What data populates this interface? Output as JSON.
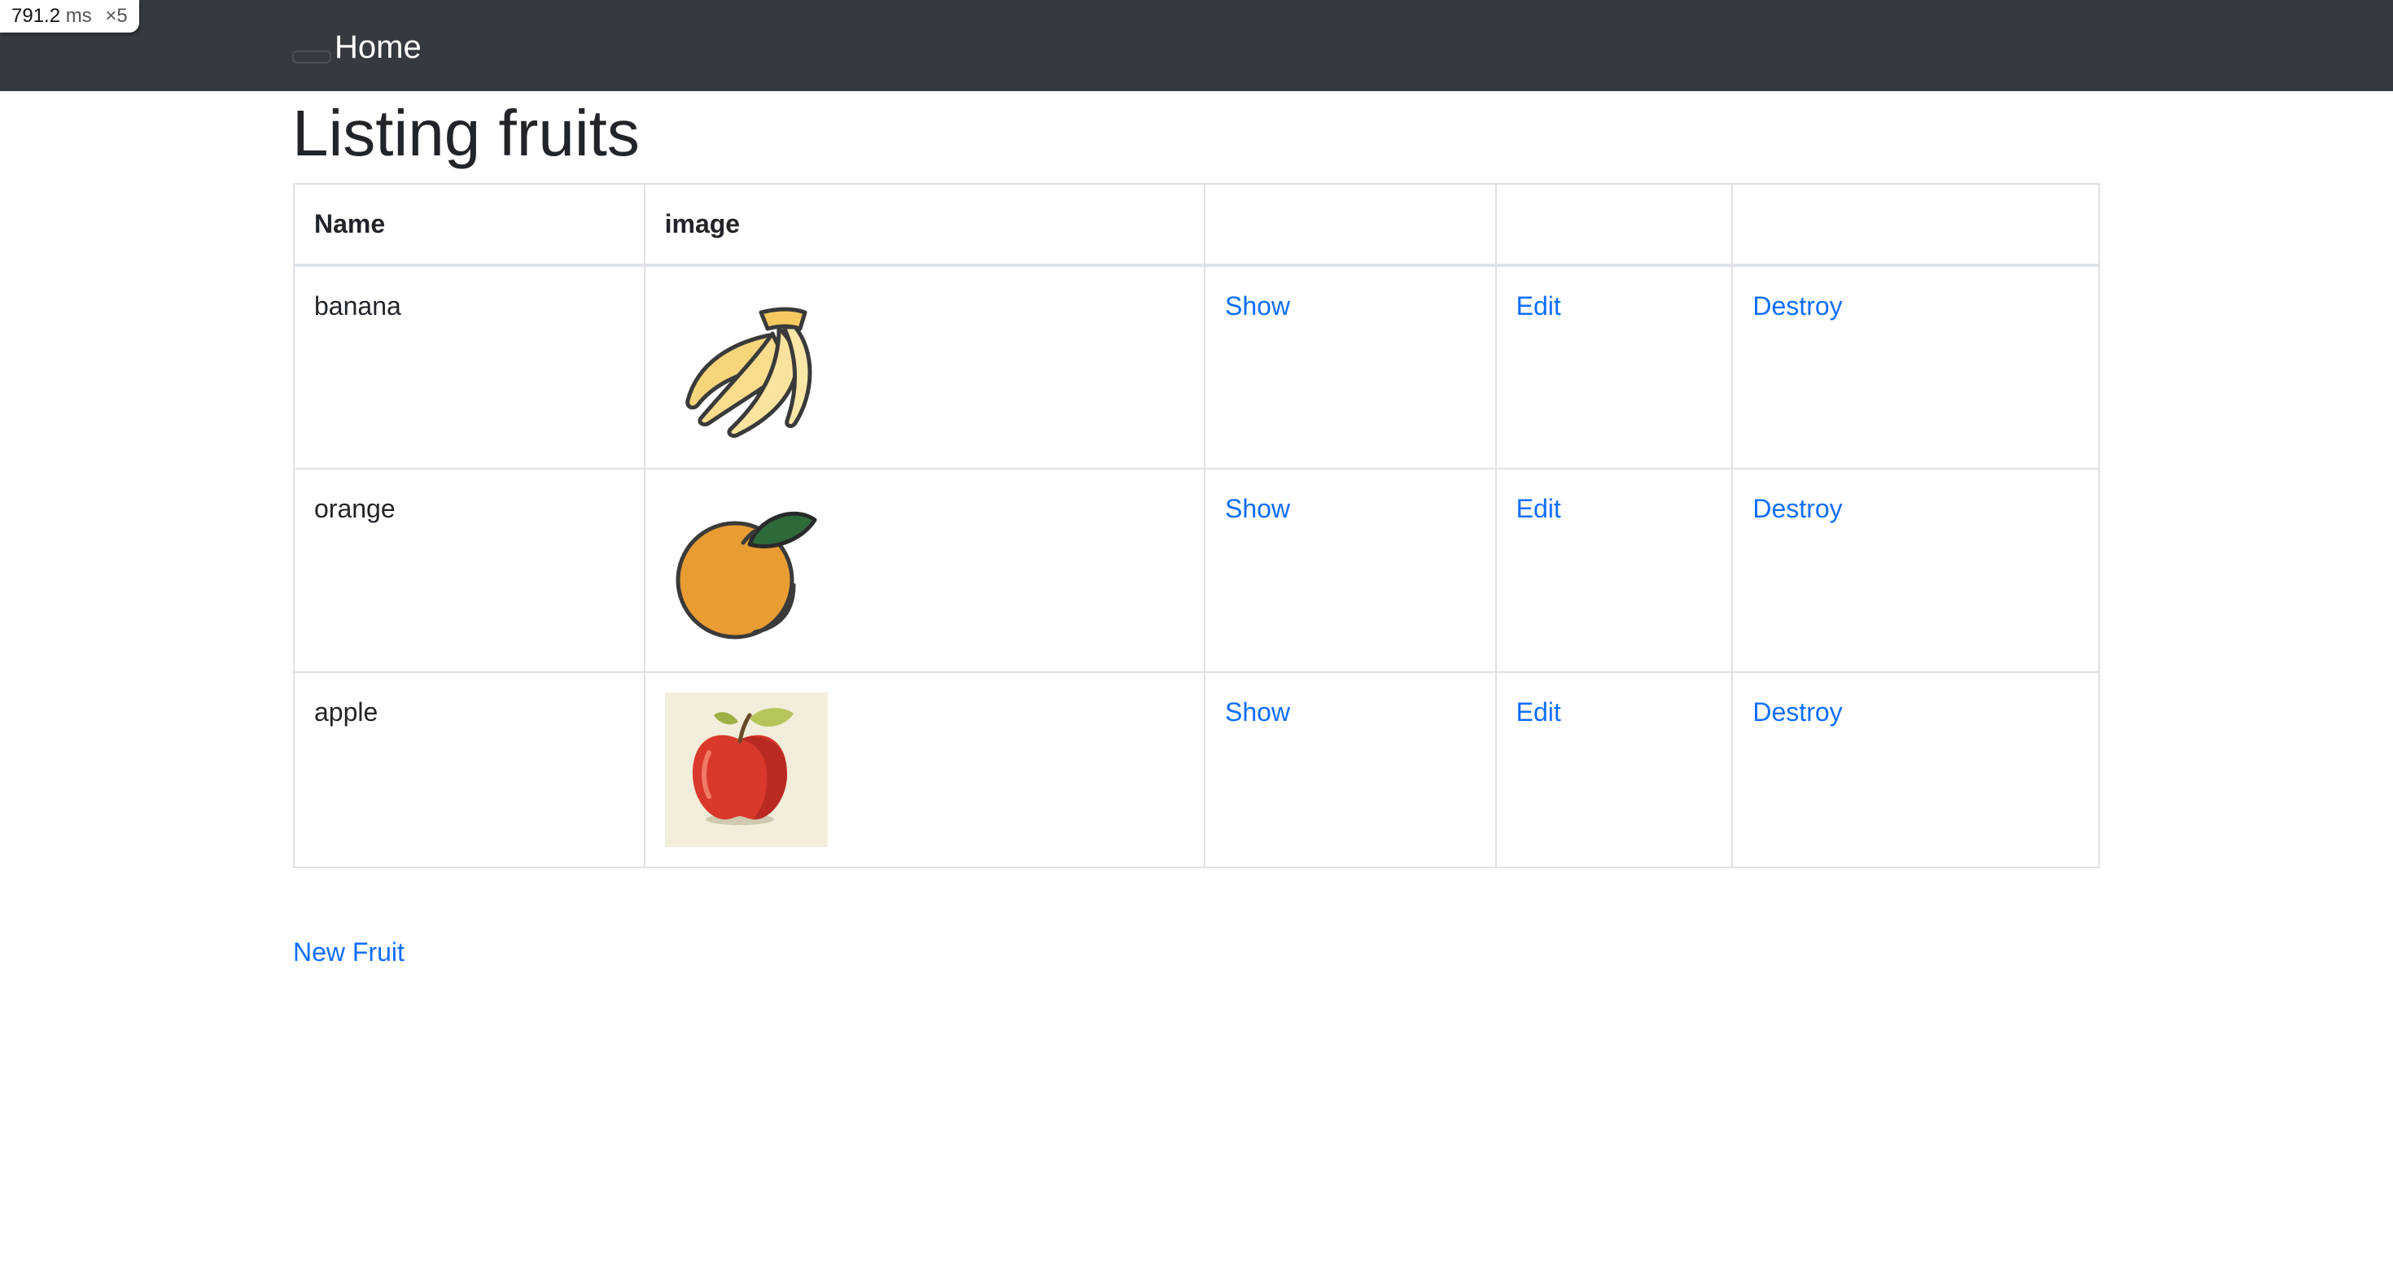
{
  "perf": {
    "value": "791.2",
    "unit": "ms",
    "multiplier": "×5"
  },
  "nav": {
    "brand": "Home"
  },
  "page": {
    "title": "Listing fruits"
  },
  "table": {
    "headers": [
      "Name",
      "image",
      "",
      "",
      ""
    ],
    "rows": [
      {
        "name": "banana",
        "image_icon": "banana-image",
        "show": "Show",
        "edit": "Edit",
        "destroy": "Destroy"
      },
      {
        "name": "orange",
        "image_icon": "orange-image",
        "show": "Show",
        "edit": "Edit",
        "destroy": "Destroy"
      },
      {
        "name": "apple",
        "image_icon": "apple-image",
        "show": "Show",
        "edit": "Edit",
        "destroy": "Destroy"
      }
    ]
  },
  "actions": {
    "new_label": "New Fruit"
  },
  "colors": {
    "navbar": "#343a40",
    "link": "#0d6efd",
    "border": "#dee2e6",
    "text": "#212529"
  }
}
